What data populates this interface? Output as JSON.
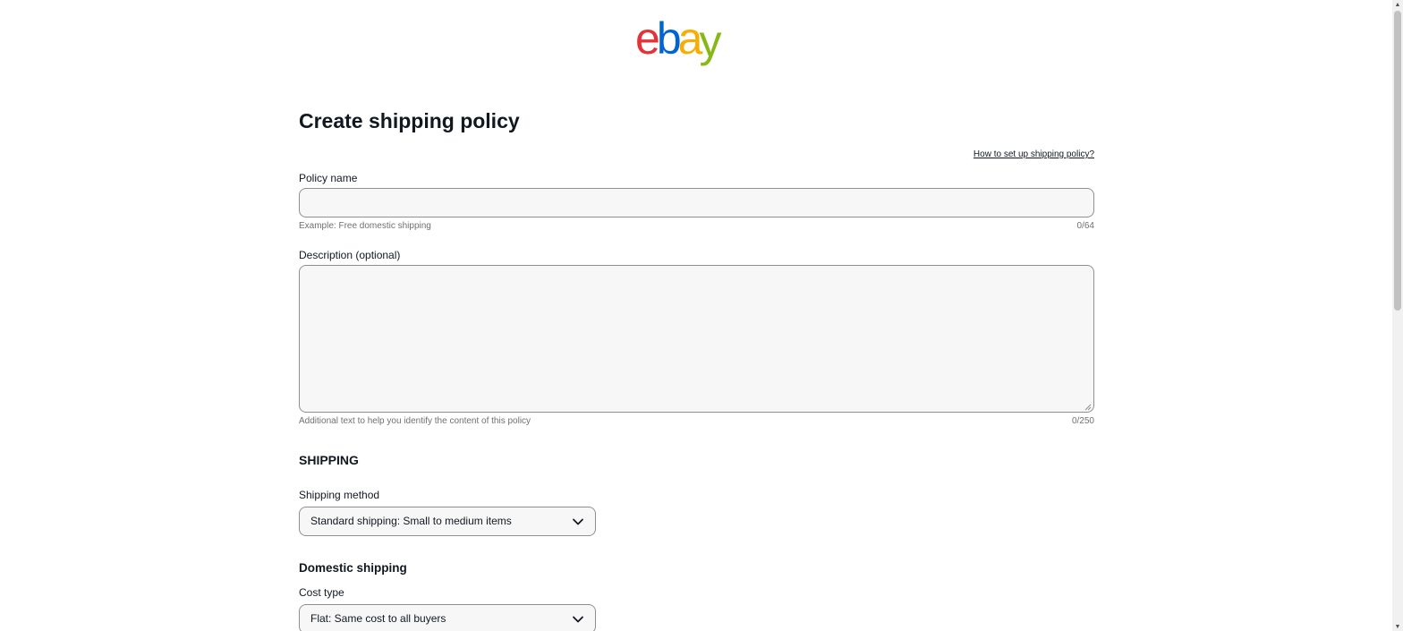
{
  "brand": {
    "logo_letters": [
      "e",
      "b",
      "a",
      "y"
    ],
    "colors": [
      "#e53238",
      "#0064d2",
      "#f5af02",
      "#86b817"
    ]
  },
  "page": {
    "title": "Create shipping policy",
    "help_link": "How to set up shipping policy?"
  },
  "policy_name": {
    "label": "Policy name",
    "value": "",
    "hint": "Example: Free domestic shipping",
    "counter": "0/64"
  },
  "description": {
    "label": "Description (optional)",
    "value": "",
    "hint": "Additional text to help you identify the content of this policy",
    "counter": "0/250"
  },
  "shipping": {
    "section_title": "SHIPPING",
    "method_label": "Shipping method",
    "method_value": "Standard shipping: Small to medium items"
  },
  "domestic": {
    "section_title": "Domestic shipping",
    "cost_type_label": "Cost type",
    "cost_type_value": "Flat: Same cost to all buyers"
  },
  "icons": {
    "select_chevron": "chevron-down-icon",
    "scroll_up": "scroll-up-arrow-icon",
    "scroll_down": "scroll-down-arrow-icon"
  }
}
